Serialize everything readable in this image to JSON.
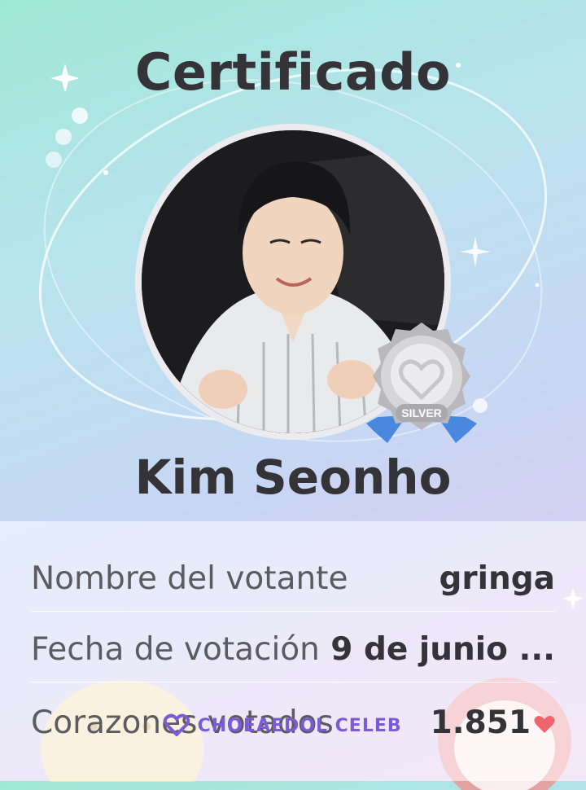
{
  "certificate": {
    "title": "Certificado",
    "celebrity_name": "Kim Seonho",
    "badge_label": "SILVER",
    "rows": [
      {
        "label": "Nombre del votante",
        "value": "gringa"
      },
      {
        "label": "Fecha de votación",
        "value": "9 de junio ..."
      },
      {
        "label": "Corazones votados",
        "value": "1.851"
      }
    ],
    "heart_icon": "heart-icon",
    "watermark": "CHOEAEDOL CELEB"
  },
  "colors": {
    "text_dark": "#333338",
    "text_label": "#5b5b60",
    "heart": "#f0646e",
    "watermark": "#7a5cd8",
    "badge_silver": "#c9c9cc",
    "ribbon": "#4a88e0"
  }
}
